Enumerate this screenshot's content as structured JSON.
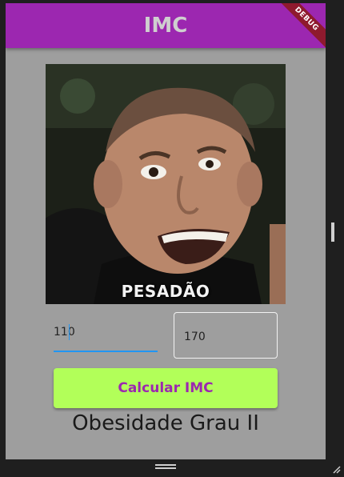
{
  "app_bar": {
    "title": "IMC",
    "debug_banner": "DEBUG"
  },
  "photo": {
    "caption": "PESADÃO",
    "icon": "meme-photo"
  },
  "inputs": {
    "weight": {
      "value": "110"
    },
    "height": {
      "value": "170"
    }
  },
  "button": {
    "label": "Calcular IMC"
  },
  "result": {
    "text": "Obesidade Grau II"
  },
  "colors": {
    "appbar": "#9c27b0",
    "background": "#9e9e9e",
    "button": "#b2ff59",
    "button_text": "#9c27b0",
    "focus_line": "#2196f3"
  }
}
